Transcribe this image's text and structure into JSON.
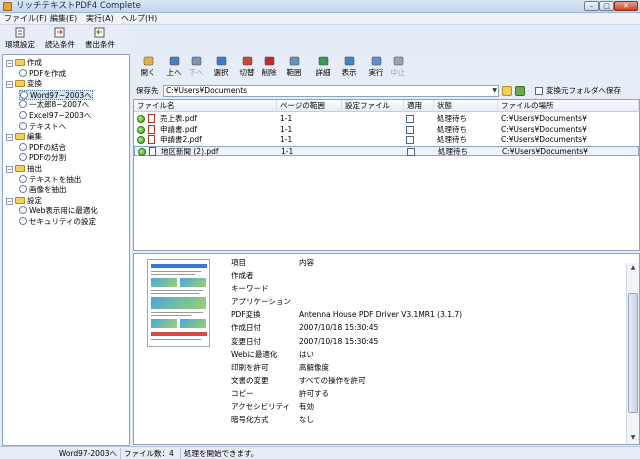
{
  "window": {
    "title": "リッチテキストPDF4 Complete",
    "min_label": "–",
    "max_label": "□",
    "close_label": "✕"
  },
  "menu": [
    "ファイル(F)",
    "編集(E)",
    "実行(A)",
    "ヘルプ(H)"
  ],
  "main_toolbar": [
    {
      "label": "環境設定",
      "icon": "settings-icon"
    },
    {
      "label": "読込条件",
      "icon": "import-conditions-icon"
    },
    {
      "label": "書出条件",
      "icon": "export-conditions-icon"
    }
  ],
  "tree": [
    {
      "label": "作成",
      "level": 0,
      "type": "folder",
      "toggle": "−"
    },
    {
      "label": "PDFを作成",
      "level": 1,
      "type": "leaf"
    },
    {
      "label": "変換",
      "level": 0,
      "type": "folder",
      "toggle": "−"
    },
    {
      "label": "Word97~2003へ",
      "level": 1,
      "type": "leaf",
      "selected": true
    },
    {
      "label": "一太郎8~2007へ",
      "level": 1,
      "type": "leaf"
    },
    {
      "label": "Excel97~2003へ",
      "level": 1,
      "type": "leaf"
    },
    {
      "label": "テキストへ",
      "level": 1,
      "type": "leaf"
    },
    {
      "label": "編集",
      "level": 0,
      "type": "folder",
      "toggle": "−"
    },
    {
      "label": "PDFの結合",
      "level": 1,
      "type": "leaf"
    },
    {
      "label": "PDFの分割",
      "level": 1,
      "type": "leaf"
    },
    {
      "label": "抽出",
      "level": 0,
      "type": "folder",
      "toggle": "−"
    },
    {
      "label": "テキストを抽出",
      "level": 1,
      "type": "leaf"
    },
    {
      "label": "画像を抽出",
      "level": 1,
      "type": "leaf"
    },
    {
      "label": "設定",
      "level": 0,
      "type": "folder",
      "toggle": "−"
    },
    {
      "label": "Web表示用に最適化",
      "level": 1,
      "type": "leaf"
    },
    {
      "label": "セキュリティの設定",
      "level": 1,
      "type": "leaf"
    }
  ],
  "right_toolbar": [
    {
      "label": "開く",
      "icon": "open-icon",
      "enabled": true
    },
    {
      "label": "上へ",
      "icon": "up-icon",
      "enabled": true
    },
    {
      "label": "下へ",
      "icon": "down-icon",
      "enabled": false
    },
    {
      "label": "選択",
      "icon": "select-icon",
      "enabled": true
    },
    {
      "label": "切替",
      "icon": "toggle-icon",
      "enabled": true
    },
    {
      "label": "削除",
      "icon": "delete-icon",
      "enabled": true
    },
    {
      "label": "範囲",
      "icon": "range-icon",
      "enabled": true
    },
    {
      "label": "詳細",
      "icon": "details-icon",
      "enabled": true
    },
    {
      "label": "表示",
      "icon": "view-icon",
      "enabled": true
    },
    {
      "label": "実行",
      "icon": "run-icon",
      "enabled": true
    },
    {
      "label": "中止",
      "icon": "stop-icon",
      "enabled": false
    }
  ],
  "save": {
    "label": "保存先",
    "path": "C:¥Users¥Documents",
    "option": "変換元フォルダへ保存"
  },
  "filelist": {
    "headers": [
      "ファイル名",
      "ページの範囲",
      "設定ファイル",
      "適用",
      "状態",
      "ファイルの場所"
    ],
    "rows": [
      {
        "name": "売上表.pdf",
        "range": "1-1",
        "setting": "",
        "status": "処理待ち",
        "location": "C:¥Users¥Documents¥"
      },
      {
        "name": "申請書.pdf",
        "range": "1-1",
        "setting": "",
        "status": "処理待ち",
        "location": "C:¥Users¥Documents¥"
      },
      {
        "name": "申請書2.pdf",
        "range": "1-1",
        "setting": "",
        "status": "処理待ち",
        "location": "C:¥Users¥Documents¥"
      },
      {
        "name": "地区新聞 (2).pdf",
        "range": "1-1",
        "setting": "",
        "status": "処理待ち",
        "location": "C:¥Users¥Documents¥"
      }
    ]
  },
  "properties": {
    "headers": [
      "項目",
      "内容"
    ],
    "rows": [
      {
        "key": "作成者",
        "value": ""
      },
      {
        "key": "キーワード",
        "value": ""
      },
      {
        "key": "アプリケーション",
        "value": ""
      },
      {
        "key": "PDF変換",
        "value": "Antenna House PDF Driver V3.1MR1 (3.1.7)"
      },
      {
        "key": "作成日付",
        "value": "2007/10/18 15:30:45"
      },
      {
        "key": "変更日付",
        "value": "2007/10/18 15:30:45"
      },
      {
        "key": "Webに最適化",
        "value": "はい"
      },
      {
        "key": "印刷を許可",
        "value": "高解像度"
      },
      {
        "key": "文書の変更",
        "value": "すべての操作を許可"
      },
      {
        "key": "コピー",
        "value": "許可する"
      },
      {
        "key": "アクセシビリティ",
        "value": "有効"
      },
      {
        "key": "暗号化方式",
        "value": "なし"
      }
    ]
  },
  "status": {
    "mode": "Word97-2003へ",
    "file_count": "ファイル数：4",
    "message": "処理を開始できます。"
  },
  "colors": {
    "accent": "#3f78d4",
    "ok": "#2d9a12",
    "pdf": "#c23022"
  }
}
